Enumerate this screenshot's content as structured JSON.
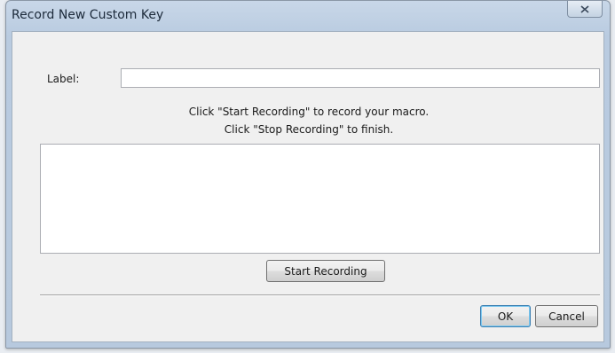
{
  "window": {
    "title": "Record New Custom Key"
  },
  "form": {
    "label_caption": "Label:",
    "label_value": "",
    "instruction_line1": "Click \"Start Recording\" to record your macro.",
    "instruction_line2": "Click \"Stop Recording\" to finish.",
    "macro_content": ""
  },
  "buttons": {
    "start_recording": "Start Recording",
    "ok": "OK",
    "cancel": "Cancel"
  },
  "icons": {
    "close": "close-icon"
  },
  "colors": {
    "title_bar": "#b9cbe0",
    "client_background": "#f0f0f0",
    "default_button_focus": "#3c7fb1"
  }
}
